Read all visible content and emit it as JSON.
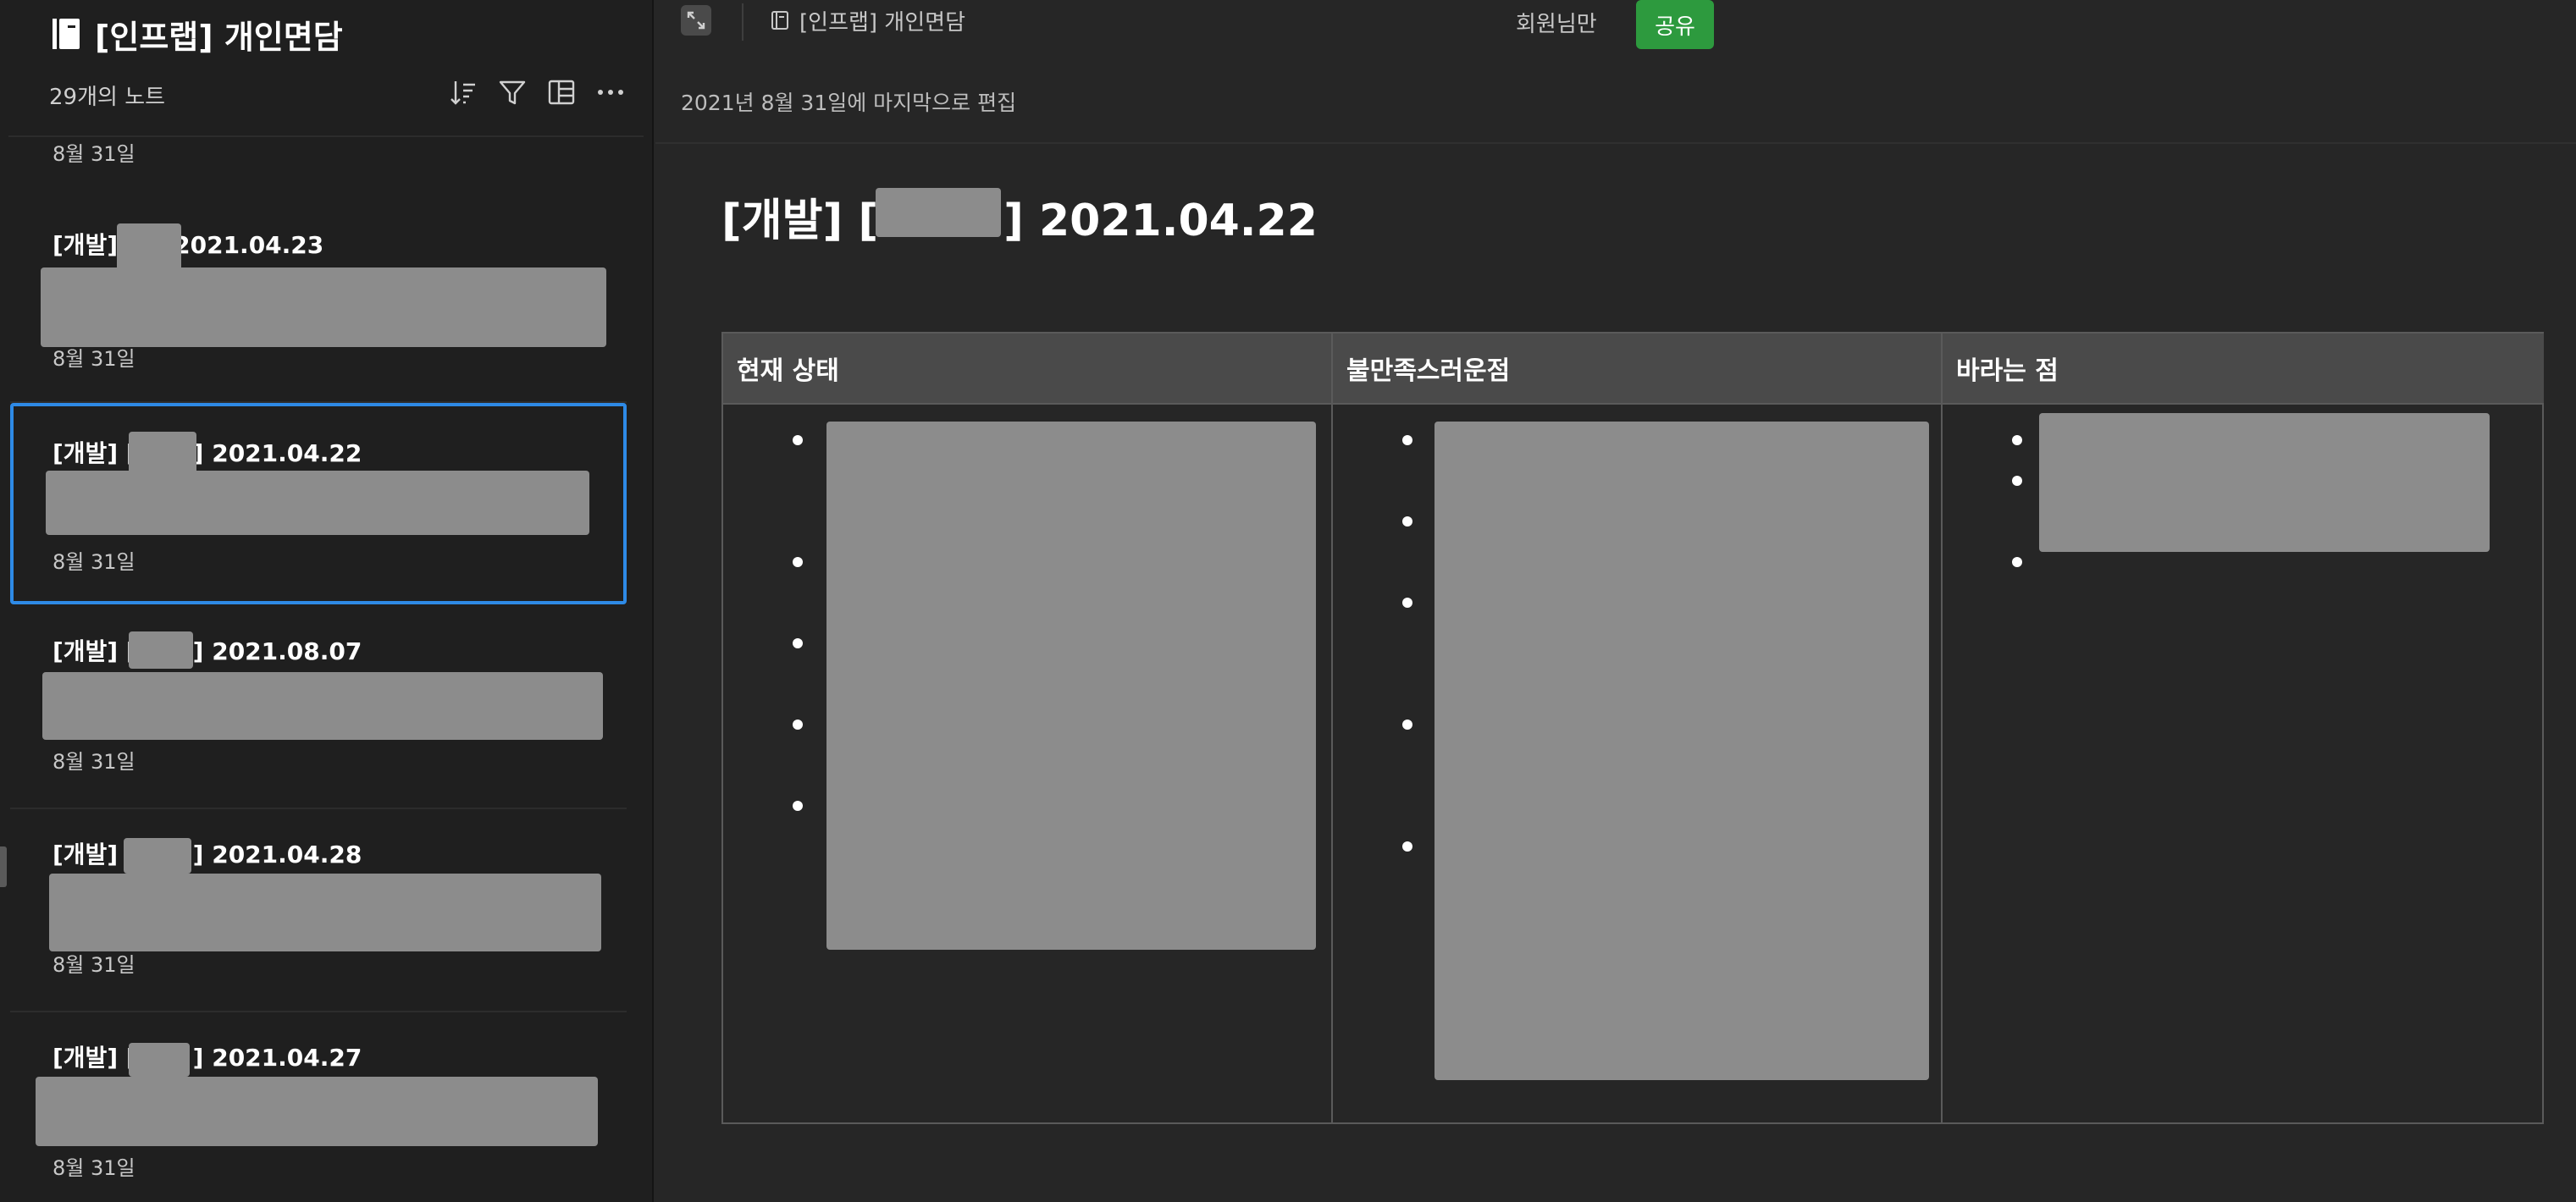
{
  "sidebar": {
    "notebook_title": "[인프랩] 개인면담",
    "note_count": "29개의 노트",
    "top_partial_date": "8월 31일",
    "tools": [
      "sort-icon",
      "filter-icon",
      "view-layout-icon",
      "more-icon"
    ],
    "notes": [
      {
        "title_prefix": "[개발]",
        "title_suffix": "2021.04.23",
        "date": "8월 31일",
        "selected": false
      },
      {
        "title_prefix": "[개발] [",
        "title_suffix": "] 2021.04.22",
        "date": "8월 31일",
        "selected": true
      },
      {
        "title_prefix": "[개발] [",
        "title_suffix": "] 2021.08.07",
        "date": "8월 31일",
        "selected": false
      },
      {
        "title_prefix": "[개발] [",
        "title_suffix": "] 2021.04.28",
        "date": "8월 31일",
        "selected": false
      },
      {
        "title_prefix": "[개발] [",
        "title_suffix": "] 2021.04.27",
        "date": "8월 31일",
        "selected": false
      }
    ]
  },
  "main": {
    "breadcrumb": "[인프랩] 개인면담",
    "members_label": "회원님만",
    "share_label": "공유",
    "last_edited": "2021년 8월 31일에 마지막으로 편집",
    "title_prefix": "[개발] [",
    "title_suffix": "] 2021.04.22",
    "table": {
      "headers": [
        "현재 상태",
        "불만족스러운점",
        "바라는 점"
      ]
    }
  },
  "colors": {
    "accent_selected": "#2e8ae6",
    "share_button": "#2d9a3e",
    "sidebar_bg": "#1f1f1f",
    "main_bg": "#262626",
    "redaction": "#8c8c8c"
  }
}
